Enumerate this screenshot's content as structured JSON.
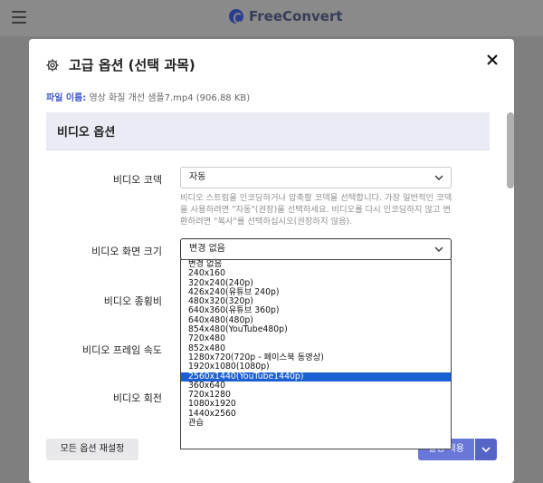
{
  "app": {
    "brand": "FreeConvert"
  },
  "modal": {
    "title": "고급 옵션 (선택 과목)",
    "file_label": "파일 이름:",
    "file_name": "영상 화질 개선 샘플7.mp4 (906.88 KB)"
  },
  "section": {
    "title": "비디오 옵션"
  },
  "fields": {
    "codec": {
      "label": "비디오 코덱",
      "value": "자동"
    },
    "codec_help": "비디오 스트림을 인코딩하거나 압축할 코덱을 선택합니다. 가장 일반적인 코덱을 사용하려면 \"자동\"(권장)을 선택하세요. 비디오를 다시 인코딩하지 않고 변환하려면 \"복사\"를 선택하십시오(권장하지 않음).",
    "size": {
      "label": "비디오 화면 크기",
      "value": "변경 없음"
    },
    "aspect": {
      "label": "비디오 종횡비"
    },
    "fps": {
      "label": "비디오 프레임 속도"
    },
    "rotate": {
      "label": "비디오 회전"
    }
  },
  "dropdown": {
    "options": [
      "변경 없음",
      "240x160",
      "320x240(240p)",
      "426x240(유튜브 240p)",
      "480x320(320p)",
      "640x360(유튜브 360p)",
      "640x480(480p)",
      "854x480(YouTube480p)",
      "720x480",
      "852x480",
      "1280x720(720p - 페이스북 동영상)",
      "1920x1080(1080p)",
      "2560x1440(YouTube1440p)",
      "360x640",
      "720x1280",
      "1080x1920",
      "1440x2560",
      "관습"
    ],
    "selected": "2560x1440(YouTube1440p)"
  },
  "buttons": {
    "reset": "모든 옵션 재설정",
    "apply": "설정 적용"
  },
  "colors": {
    "accent": "#6877d8",
    "selected_option": "#1b5fd2"
  }
}
